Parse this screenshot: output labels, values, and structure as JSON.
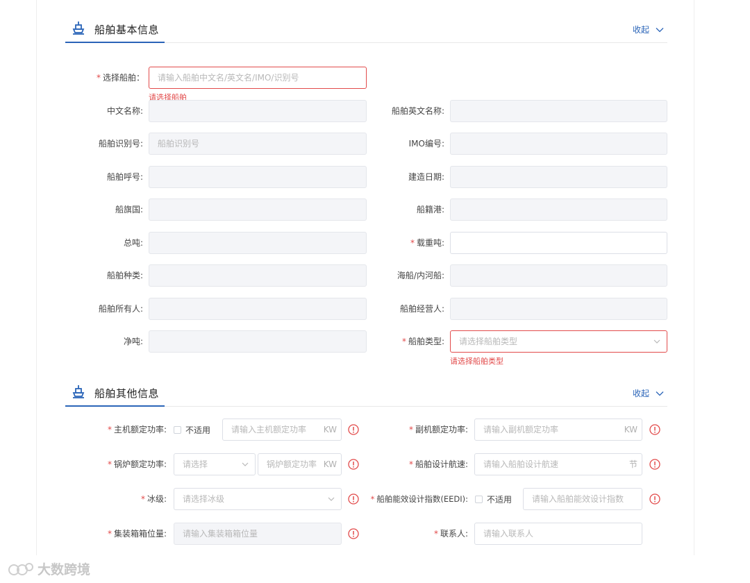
{
  "section1": {
    "title": "船舶基本信息",
    "collapse_label": "收起"
  },
  "section2": {
    "title": "船舶其他信息",
    "collapse_label": "收起"
  },
  "basic": {
    "select_ship": {
      "label": "选择船舶：",
      "placeholder": "请输入船舶中文名/英文名/IMO/识别号",
      "error": "请选择船舶"
    },
    "cn_name": {
      "label": "中文名称:"
    },
    "en_name": {
      "label": "船舶英文名称:"
    },
    "ship_id": {
      "label": "船舶识别号:",
      "placeholder": "船舶识别号"
    },
    "imo": {
      "label": "IMO编号:"
    },
    "call_sign": {
      "label": "船舶呼号:"
    },
    "build_date": {
      "label": "建造日期:"
    },
    "flag": {
      "label": "船旗国:"
    },
    "port_registry": {
      "label": "船籍港:"
    },
    "gross_ton": {
      "label": "总吨:"
    },
    "dwt": {
      "label": "载重吨:"
    },
    "ship_kind": {
      "label": "船舶种类:"
    },
    "sea_river": {
      "label": "海船/内河船:"
    },
    "owner": {
      "label": "船舶所有人:"
    },
    "operator": {
      "label": "船舶经营人:"
    },
    "net_ton": {
      "label": "净吨:"
    },
    "ship_type": {
      "label": "船舶类型:",
      "placeholder": "请选择船舶类型",
      "error": "请选择船舶类型"
    }
  },
  "other": {
    "main_engine": {
      "label": "主机额定功率:",
      "na": "不适用",
      "placeholder": "请输入主机额定功率",
      "unit": "KW"
    },
    "aux_engine": {
      "label": "副机额定功率:",
      "placeholder": "请输入副机额定功率",
      "unit": "KW"
    },
    "boiler": {
      "label": "锅炉额定功率:",
      "select_placeholder": "请选择",
      "placeholder": "锅炉额定功率",
      "unit": "KW"
    },
    "design_speed": {
      "label": "船舶设计航速:",
      "placeholder": "请输入船舶设计航速",
      "unit": "节"
    },
    "ice_class": {
      "label": "冰级:",
      "placeholder": "请选择冰级"
    },
    "eedi": {
      "label": "船舶能效设计指数(EEDI):",
      "na": "不适用",
      "placeholder": "请输入船舶能效设计指数"
    },
    "container": {
      "label": "集装箱箱位量:",
      "placeholder": "请输入集装箱箱位量"
    },
    "contact": {
      "label": "联系人:",
      "placeholder": "请输入联系人"
    }
  },
  "watermark": {
    "text": "大数跨境"
  },
  "colors": {
    "accent": "#2a64b8",
    "error": "#e24a4a",
    "disabled_bg": "#f4f5f8"
  }
}
